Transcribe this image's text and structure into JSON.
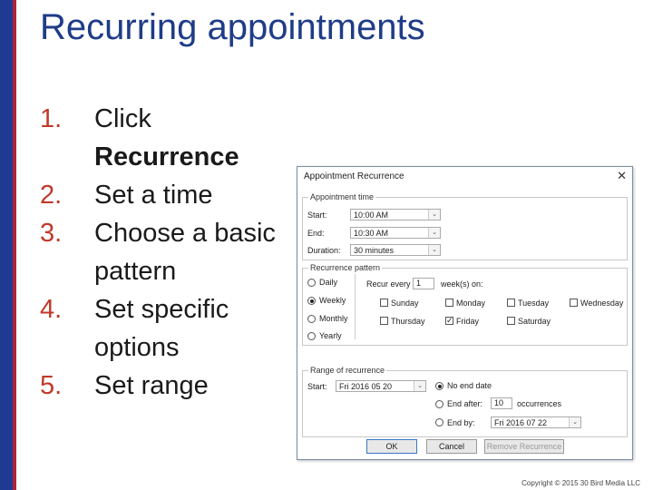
{
  "slide": {
    "title": "Recurring appointments",
    "copyright": "Copyright © 2015 30 Bird Media LLC",
    "steps": [
      {
        "num": "1.",
        "text": "Click ",
        "bold": "Recurrence"
      },
      {
        "num": "2.",
        "text": "Set a time"
      },
      {
        "num": "3.",
        "text": "Choose a basic pattern"
      },
      {
        "num": "4.",
        "text": "Set specific options"
      },
      {
        "num": "5.",
        "text": "Set range"
      }
    ]
  },
  "dialog": {
    "title": "Appointment Recurrence",
    "close": "✕",
    "time": {
      "group_label": "Appointment time",
      "start_label": "Start:",
      "start_value": "10:00 AM",
      "end_label": "End:",
      "end_value": "10:30 AM",
      "duration_label": "Duration:",
      "duration_value": "30 minutes"
    },
    "pattern": {
      "group_label": "Recurrence pattern",
      "options": [
        "Daily",
        "Weekly",
        "Monthly",
        "Yearly"
      ],
      "selected": "Weekly",
      "recur_every_label": "Recur every",
      "recur_every_value": "1",
      "weeks_on_label": "week(s) on:",
      "days": [
        {
          "label": "Sunday",
          "checked": false
        },
        {
          "label": "Monday",
          "checked": false
        },
        {
          "label": "Tuesday",
          "checked": false
        },
        {
          "label": "Wednesday",
          "checked": false
        },
        {
          "label": "Thursday",
          "checked": false
        },
        {
          "label": "Friday",
          "checked": true
        },
        {
          "label": "Saturday",
          "checked": false
        }
      ]
    },
    "range": {
      "group_label": "Range of recurrence",
      "start_label": "Start:",
      "start_value": "Fri 2016 05 20",
      "no_end_label": "No end date",
      "end_after_label": "End after:",
      "end_after_value": "10",
      "occurrences_label": "occurrences",
      "end_by_label": "End by:",
      "end_by_value": "Fri 2016 07 22",
      "selected": "No end date"
    },
    "buttons": {
      "ok": "OK",
      "cancel": "Cancel",
      "remove": "Remove Recurrence"
    }
  },
  "colors": {
    "title": "#1f3c88",
    "number": "#c0392b",
    "left_bar": "#1f3a93",
    "left_stripe": "#b22234"
  }
}
